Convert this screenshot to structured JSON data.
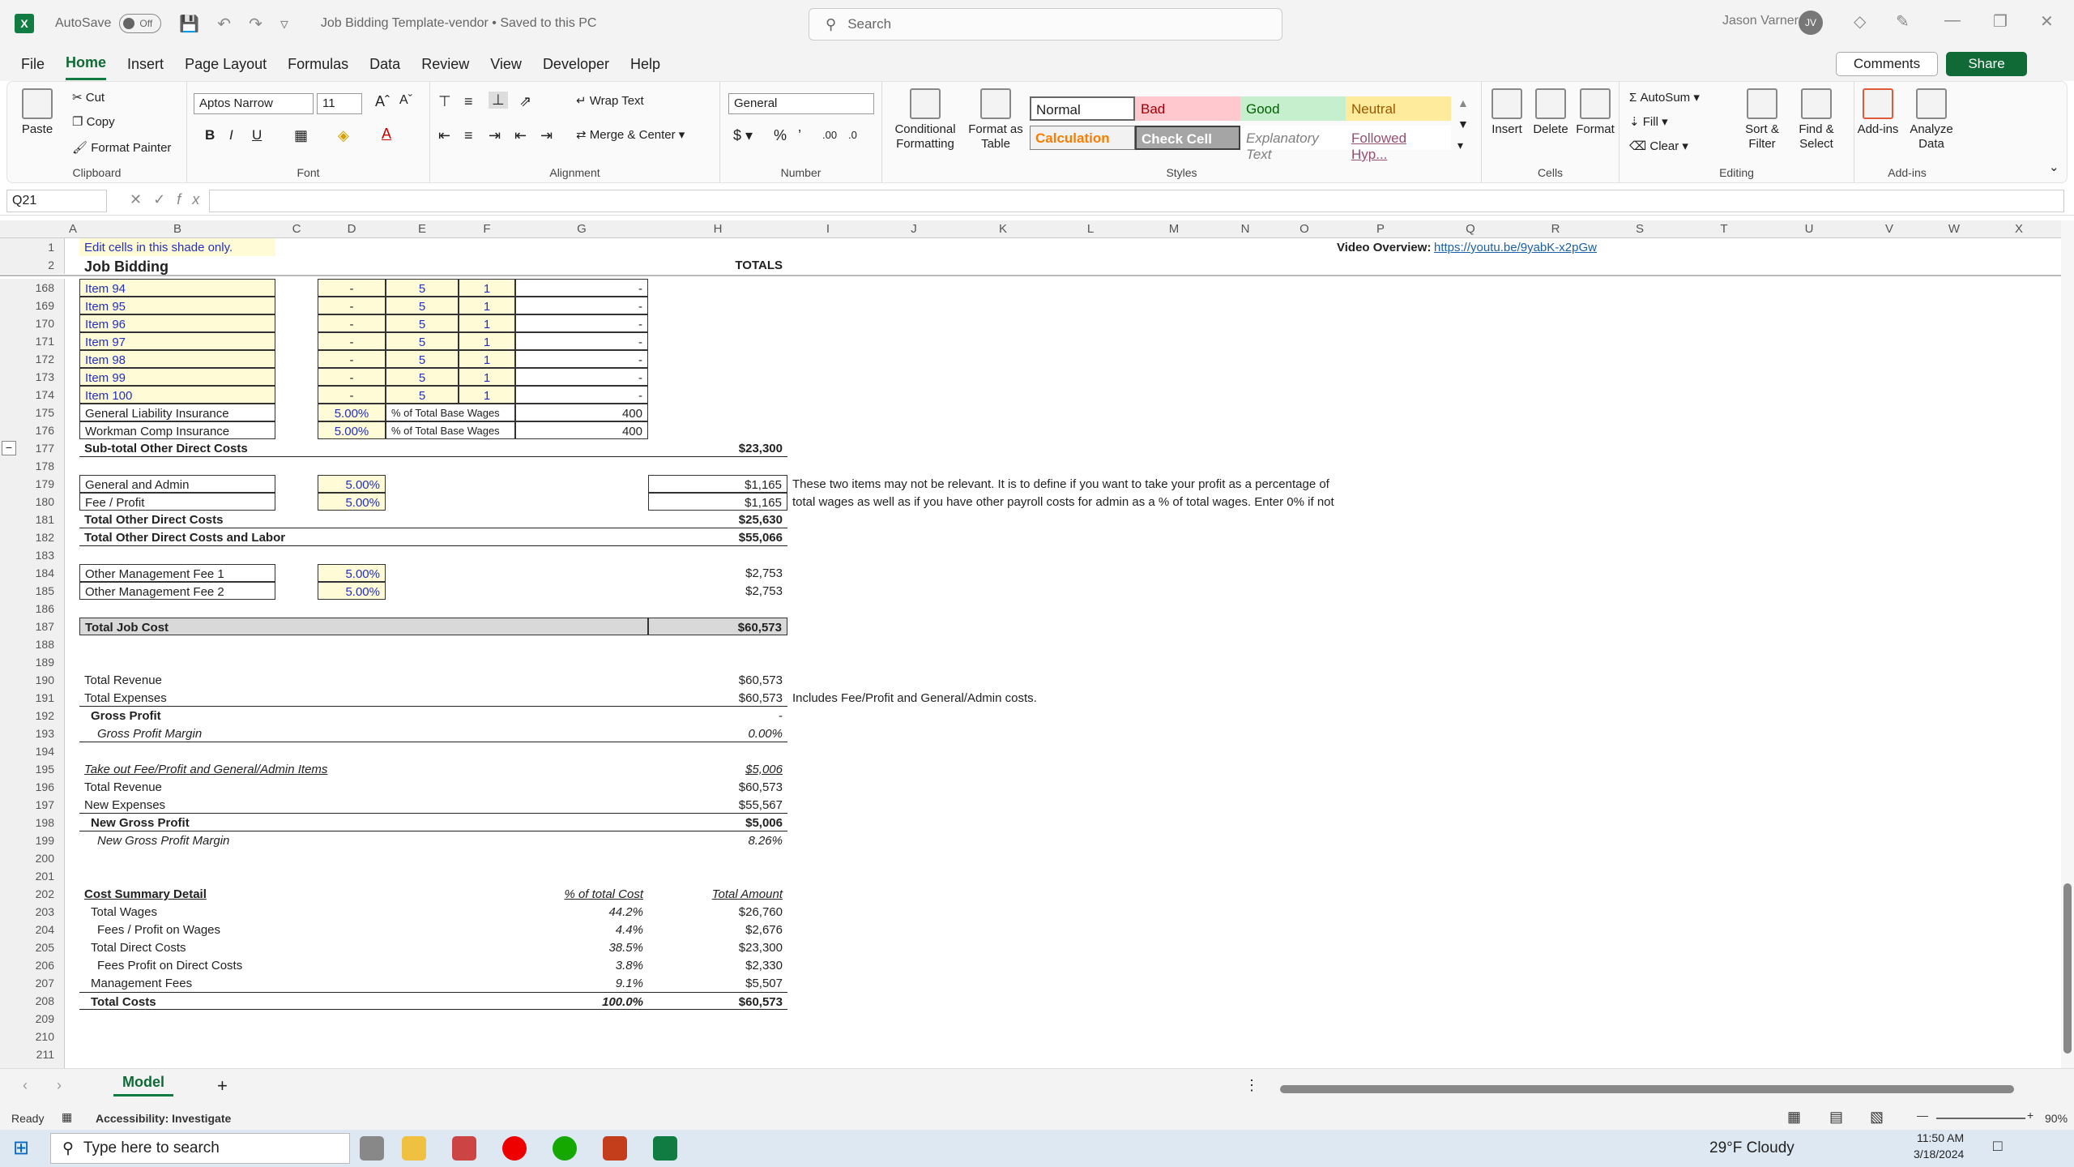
{
  "titlebar": {
    "autosave": "AutoSave",
    "toggle": "Off",
    "doc_title": "Job Bidding Template-vendor • Saved to this PC",
    "search_placeholder": "Search",
    "user": "Jason Varner",
    "initials": "JV"
  },
  "menu": {
    "tabs": [
      "File",
      "Home",
      "Insert",
      "Page Layout",
      "Formulas",
      "Data",
      "Review",
      "View",
      "Developer",
      "Help"
    ],
    "comments": "Comments",
    "share": "Share"
  },
  "ribbon": {
    "clipboard": {
      "paste": "Paste",
      "cut": "Cut",
      "copy": "Copy",
      "format_painter": "Format Painter",
      "label": "Clipboard"
    },
    "font": {
      "name": "Aptos Narrow",
      "size": "11",
      "label": "Font"
    },
    "alignment": {
      "wrap": "Wrap Text",
      "merge": "Merge & Center",
      "label": "Alignment"
    },
    "number": {
      "format": "General",
      "label": "Number"
    },
    "styles": {
      "conditional": "Conditional Formatting",
      "format_table": "Format as Table",
      "normal": "Normal",
      "bad": "Bad",
      "good": "Good",
      "neutral": "Neutral",
      "calculation": "Calculation",
      "check_cell": "Check Cell",
      "explanatory": "Explanatory Text",
      "followed": "Followed Hyp...",
      "label": "Styles"
    },
    "cells": {
      "insert": "Insert",
      "delete": "Delete",
      "format": "Format",
      "label": "Cells"
    },
    "editing": {
      "autosum": "AutoSum",
      "fill": "Fill",
      "clear": "Clear",
      "sort": "Sort & Filter",
      "find": "Find & Select",
      "label": "Editing"
    },
    "addins": {
      "addins": "Add-ins",
      "analyze": "Analyze Data",
      "label": "Add-ins"
    }
  },
  "formula_bar": {
    "name_box": "Q21",
    "fx": "fx",
    "value": ""
  },
  "columns": [
    "A",
    "B",
    "C",
    "D",
    "E",
    "F",
    "G",
    "H",
    "I",
    "J",
    "K",
    "L",
    "M",
    "N",
    "O",
    "P",
    "Q",
    "R",
    "S",
    "T",
    "U",
    "V",
    "W",
    "X"
  ],
  "sheet": {
    "r1_note": "Edit cells in this shade only.",
    "video_label": "Video Overview:",
    "video_link": "https://youtu.be/9yabK-x2pGw",
    "title": "Job Bidding",
    "totals": "TOTALS",
    "items": [
      {
        "row": "168",
        "name": "Item 94",
        "d": "-",
        "e": "5",
        "f": "1",
        "g": "-"
      },
      {
        "row": "169",
        "name": "Item 95",
        "d": "-",
        "e": "5",
        "f": "1",
        "g": "-"
      },
      {
        "row": "170",
        "name": "Item 96",
        "d": "-",
        "e": "5",
        "f": "1",
        "g": "-"
      },
      {
        "row": "171",
        "name": "Item 97",
        "d": "-",
        "e": "5",
        "f": "1",
        "g": "-"
      },
      {
        "row": "172",
        "name": "Item 98",
        "d": "-",
        "e": "5",
        "f": "1",
        "g": "-"
      },
      {
        "row": "173",
        "name": "Item 99",
        "d": "-",
        "e": "5",
        "f": "1",
        "g": "-"
      },
      {
        "row": "174",
        "name": "Item 100",
        "d": "-",
        "e": "5",
        "f": "1",
        "g": "-"
      }
    ],
    "insurance": [
      {
        "row": "175",
        "name": "General Liability Insurance",
        "pct": "5.00%",
        "basis": "% of Total Base Wages",
        "amt": "400"
      },
      {
        "row": "176",
        "name": "Workman Comp Insurance",
        "pct": "5.00%",
        "basis": "% of Total Base Wages",
        "amt": "400"
      }
    ],
    "r177": {
      "label": "Sub-total Other Direct Costs",
      "val": "$23,300"
    },
    "r179": {
      "label": "General and Admin",
      "pct": "5.00%",
      "val": "$1,165",
      "note": "These two items may not be relevant. It is to define if you want to take your profit as a percentage of"
    },
    "r180": {
      "label": "Fee / Profit",
      "pct": "5.00%",
      "val": "$1,165",
      "note": "total wages as well as if you have other payroll costs for admin as a % of total wages. Enter 0% if not"
    },
    "r181": {
      "label": "Total Other Direct Costs",
      "val": "$25,630"
    },
    "r182": {
      "label": "Total Other Direct Costs and Labor",
      "val": "$55,066"
    },
    "r184": {
      "label": "Other Management Fee 1",
      "pct": "5.00%",
      "val": "$2,753"
    },
    "r185": {
      "label": "Other Management Fee 2",
      "pct": "5.00%",
      "val": "$2,753"
    },
    "r187": {
      "label": "Total Job Cost",
      "val": "$60,573"
    },
    "r190": {
      "label": "Total Revenue",
      "val": "$60,573"
    },
    "r191": {
      "label": "Total Expenses",
      "val": "$60,573",
      "note": "Includes Fee/Profit and General/Admin costs."
    },
    "r192": {
      "label": "Gross Profit",
      "val": "-"
    },
    "r193": {
      "label": "Gross Profit Margin",
      "val": "0.00%"
    },
    "r195": {
      "label": "Take out Fee/Profit and General/Admin Items",
      "val": "$5,006"
    },
    "r196": {
      "label": "Total Revenue",
      "val": "$60,573"
    },
    "r197": {
      "label": "New Expenses",
      "val": "$55,567"
    },
    "r198": {
      "label": "New Gross Profit",
      "val": "$5,006"
    },
    "r199": {
      "label": "New Gross Profit Margin",
      "val": "8.26%"
    },
    "r202": {
      "label": "Cost Summary Detail",
      "pct": "% of total Cost",
      "amt": "Total Amount"
    },
    "summary": [
      {
        "row": "203",
        "label": "Total Wages",
        "pct": "44.2%",
        "amt": "$26,760"
      },
      {
        "row": "204",
        "label": "Fees / Profit on Wages",
        "pct": "4.4%",
        "amt": "$2,676"
      },
      {
        "row": "205",
        "label": "Total Direct Costs",
        "pct": "38.5%",
        "amt": "$23,300"
      },
      {
        "row": "206",
        "label": "Fees Profit on Direct Costs",
        "pct": "3.8%",
        "amt": "$2,330"
      },
      {
        "row": "207",
        "label": "Management Fees",
        "pct": "9.1%",
        "amt": "$5,507"
      },
      {
        "row": "208",
        "label": "Total Costs",
        "pct": "100.0%",
        "amt": "$60,573"
      }
    ],
    "empty_rows": [
      "178",
      "183",
      "186",
      "188",
      "189",
      "194",
      "200",
      "201",
      "209",
      "210",
      "211"
    ]
  },
  "tabs": {
    "sheet": "Model"
  },
  "status": {
    "ready": "Ready",
    "accessibility": "Accessibility: Investigate",
    "zoom": "90%"
  },
  "taskbar": {
    "search": "Type here to search",
    "weather": "29°F  Cloudy",
    "time": "11:50 AM",
    "date": "3/18/2024"
  }
}
